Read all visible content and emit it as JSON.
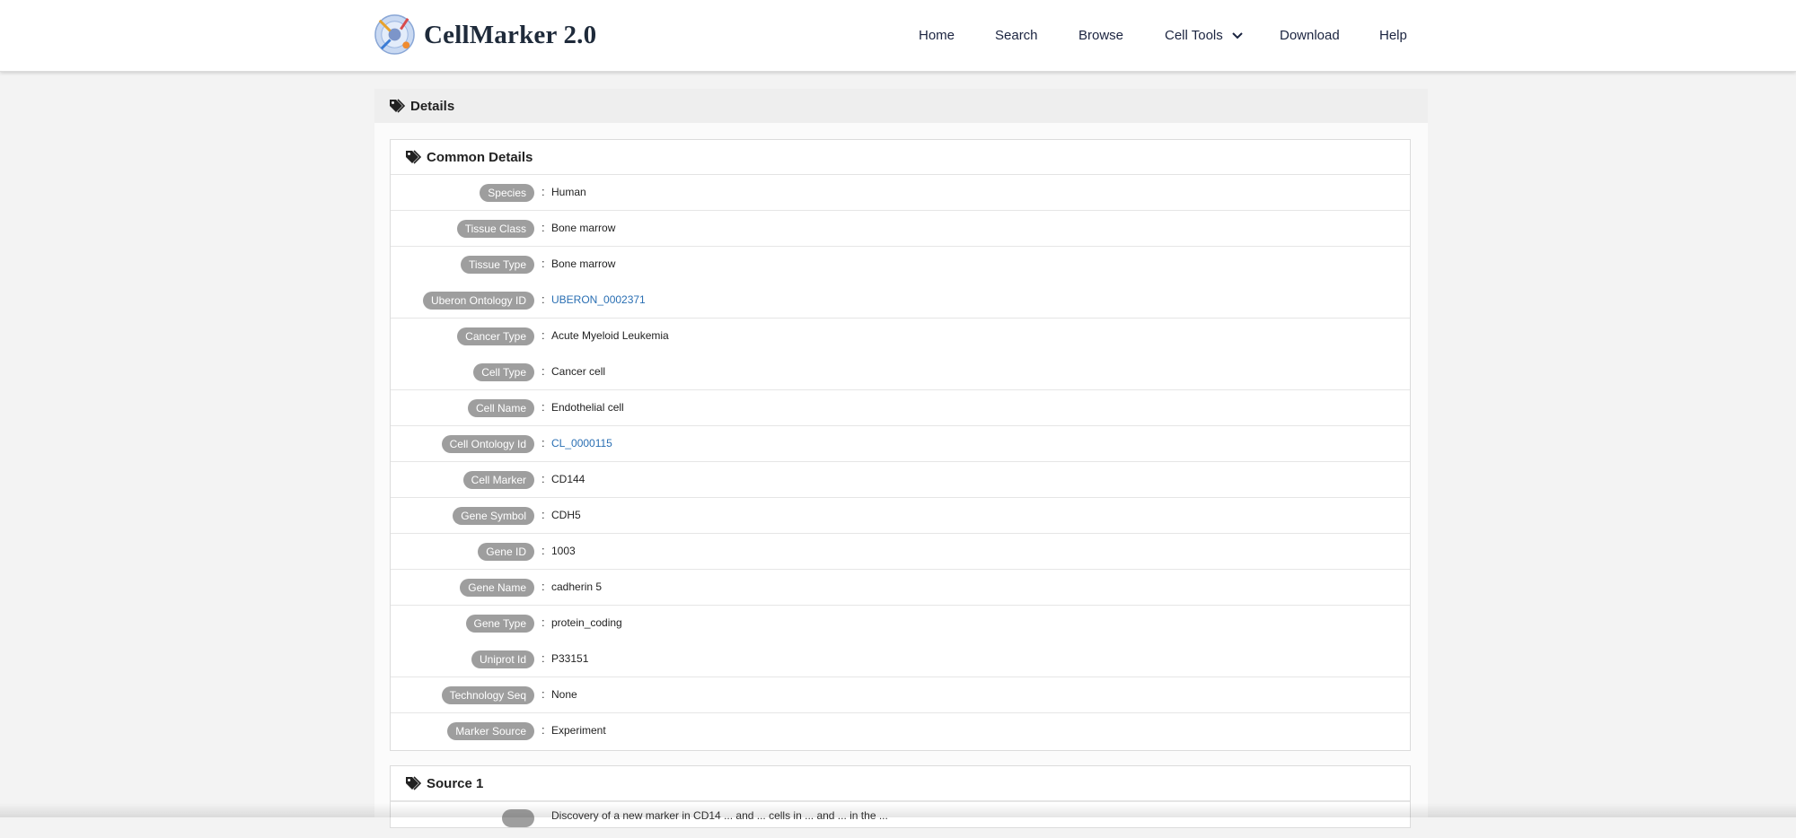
{
  "brand": {
    "name": "CellMarker 2.0"
  },
  "nav": {
    "home": "Home",
    "search": "Search",
    "browse": "Browse",
    "cell_tools": "Cell Tools",
    "download": "Download",
    "help": "Help"
  },
  "details": {
    "title": "Details",
    "common": {
      "title": "Common Details",
      "rows": [
        {
          "label": "Species",
          "value": "Human"
        },
        {
          "label": "Tissue Class",
          "value": "Bone marrow"
        },
        {
          "label": "Tissue Type",
          "value": "Bone marrow"
        },
        {
          "label": "Uberon Ontology ID",
          "value": "UBERON_0002371"
        },
        {
          "label": "Cancer Type",
          "value": "Acute Myeloid Leukemia"
        },
        {
          "label": "Cell Type",
          "value": "Cancer cell"
        },
        {
          "label": "Cell Name",
          "value": "Endothelial cell"
        },
        {
          "label": "Cell Ontology Id",
          "value": "CL_0000115"
        },
        {
          "label": "Cell Marker",
          "value": "CD144"
        },
        {
          "label": "Gene Symbol",
          "value": "CDH5"
        },
        {
          "label": "Gene ID",
          "value": "1003"
        },
        {
          "label": "Gene Name",
          "value": "cadherin 5"
        },
        {
          "label": "Gene Type",
          "value": "protein_coding"
        },
        {
          "label": "Uniprot Id",
          "value": "P33151"
        },
        {
          "label": "Technology Seq",
          "value": "None"
        },
        {
          "label": "Marker Source",
          "value": "Experiment"
        }
      ],
      "separator": ":"
    },
    "source": {
      "title": "Source 1",
      "first_value": "Discovery of a new marker in CD14 ... and ... cells in ... and ... in the ..."
    }
  },
  "colors": {
    "badge": "#9e9e9e",
    "link": "#2a6fb3",
    "panel_head": "#eeeeee"
  }
}
